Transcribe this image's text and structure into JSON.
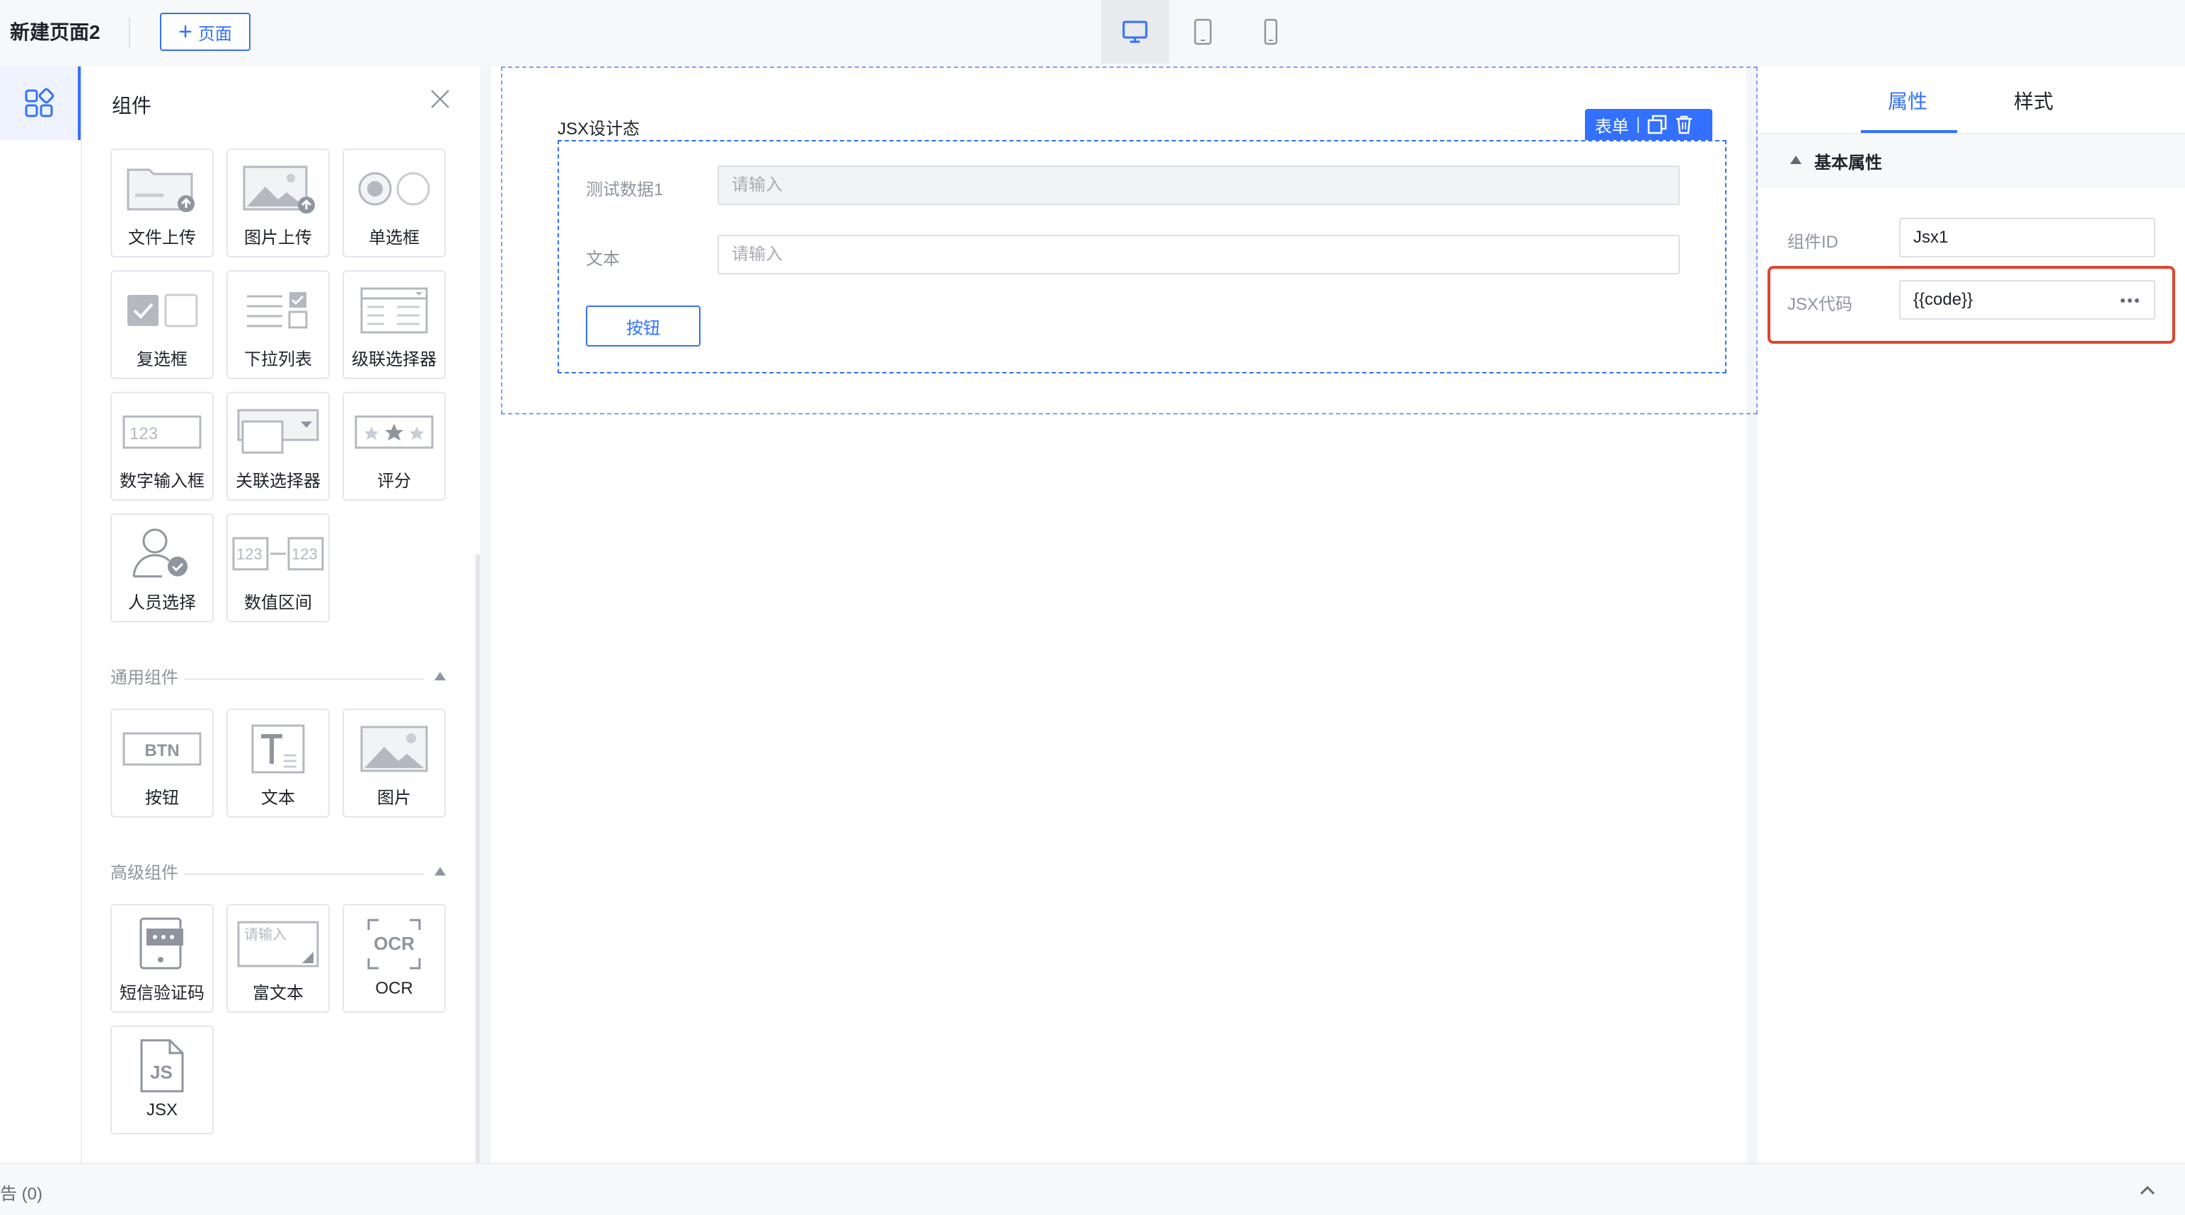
{
  "topbar": {
    "page_name": "新建页面2",
    "add_page_label": "页面"
  },
  "component_panel": {
    "title": "组件",
    "form_items": [
      {
        "label": "文件上传",
        "icon": "file-upload-icon"
      },
      {
        "label": "图片上传",
        "icon": "image-upload-icon"
      },
      {
        "label": "单选框",
        "icon": "radio-icon"
      },
      {
        "label": "复选框",
        "icon": "checkbox-icon"
      },
      {
        "label": "下拉列表",
        "icon": "dropdown-list-icon"
      },
      {
        "label": "级联选择器",
        "icon": "cascader-icon"
      },
      {
        "label": "数字输入框",
        "icon": "number-input-icon"
      },
      {
        "label": "关联选择器",
        "icon": "relation-select-icon"
      },
      {
        "label": "评分",
        "icon": "rating-icon"
      },
      {
        "label": "人员选择",
        "icon": "person-select-icon"
      },
      {
        "label": "数值区间",
        "icon": "number-range-icon"
      }
    ],
    "general_section": "通用组件",
    "general_items": [
      {
        "label": "按钮",
        "icon": "button-icon"
      },
      {
        "label": "文本",
        "icon": "text-icon"
      },
      {
        "label": "图片",
        "icon": "image-icon"
      }
    ],
    "advanced_section": "高级组件",
    "advanced_items": [
      {
        "label": "短信验证码",
        "icon": "sms-code-icon"
      },
      {
        "label": "富文本",
        "icon": "rich-text-icon"
      },
      {
        "label": "OCR",
        "icon": "ocr-icon"
      },
      {
        "label": "JSX",
        "icon": "jsx-icon"
      }
    ],
    "icon_text": {
      "number": "123",
      "btn": "BTN",
      "rich_placeholder": "请输入",
      "ocr": "OCR",
      "js": "JS"
    }
  },
  "canvas": {
    "jsx_title": "JSX设计态",
    "toolbar_label": "表单",
    "fields": [
      {
        "label": "测试数据1",
        "placeholder": "请输入"
      },
      {
        "label": "文本",
        "placeholder": "请输入"
      }
    ],
    "button_label": "按钮"
  },
  "properties": {
    "tabs": [
      "属性",
      "样式"
    ],
    "group_title": "基本属性",
    "component_id_label": "组件ID",
    "component_id_value": "Jsx1",
    "jsx_code_label": "JSX代码",
    "jsx_code_value": "{{code}}"
  },
  "bottombar": {
    "warn_text": "告 (0)"
  },
  "colors": {
    "accent": "#3370ff",
    "highlight": "#e0442b"
  }
}
